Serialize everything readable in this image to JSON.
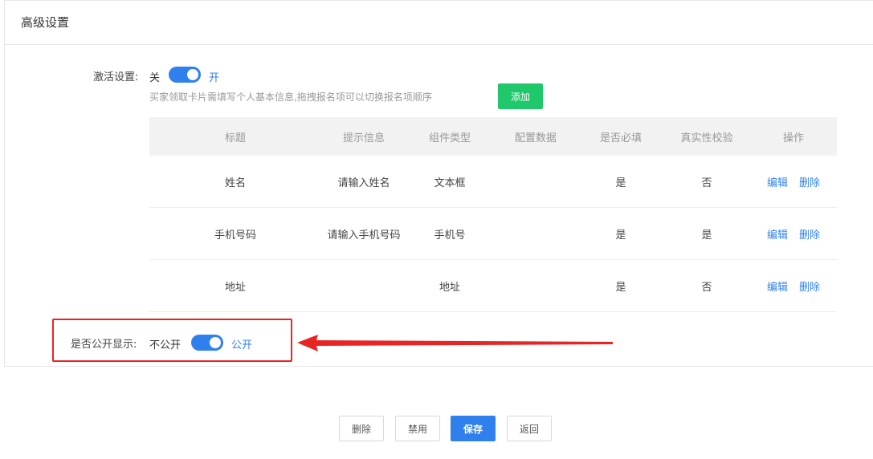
{
  "section": {
    "title": "高级设置"
  },
  "activation": {
    "label": "激活设置:",
    "off_label": "关",
    "on_label": "开",
    "hint": "买家领取卡片需填写个人基本信息,拖拽报名项可以切换报名项顺序",
    "add_button": "添加"
  },
  "table": {
    "headers": [
      "标题",
      "提示信息",
      "组件类型",
      "配置数据",
      "是否必填",
      "真实性校验",
      "操作"
    ],
    "rows": [
      {
        "title": "姓名",
        "hint": "请输入姓名",
        "type": "文本框",
        "config": "",
        "required": "是",
        "verify": "否"
      },
      {
        "title": "手机号码",
        "hint": "请输入手机号码",
        "type": "手机号",
        "config": "",
        "required": "是",
        "verify": "是"
      },
      {
        "title": "地址",
        "hint": "",
        "type": "地址",
        "config": "",
        "required": "是",
        "verify": "否"
      }
    ],
    "edit_label": "编辑",
    "delete_label": "删除"
  },
  "public_display": {
    "label": "是否公开显示:",
    "off_label": "不公开",
    "on_label": "公开"
  },
  "footer": {
    "delete": "删除",
    "disable": "禁用",
    "save": "保存",
    "back": "返回"
  },
  "colors": {
    "accent": "#2f80ed",
    "add_button": "#1fc96b",
    "annotation": "#e92424"
  }
}
